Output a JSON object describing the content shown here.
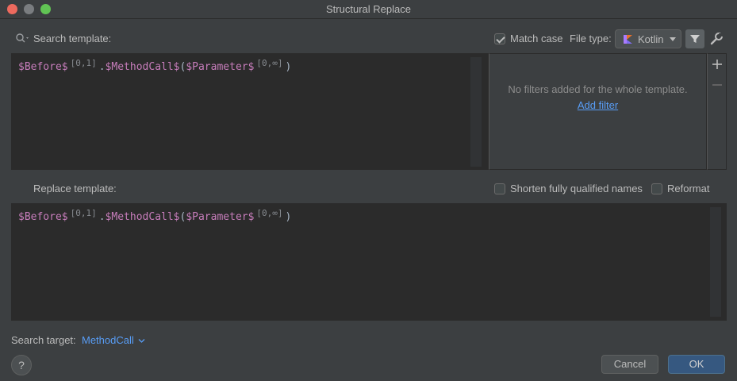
{
  "window": {
    "title": "Structural Replace"
  },
  "search": {
    "label": "Search template:",
    "match_case_label": "Match case",
    "match_case_checked": true,
    "file_type_label": "File type:",
    "file_type_value": "Kotlin",
    "code": {
      "before": "$Before$",
      "before_badge": "[0,1]",
      "dot": ".",
      "method": "$MethodCall$",
      "open_paren": "(",
      "param": "$Parameter$",
      "param_badge": "[0,∞]",
      "close_paren": ")"
    }
  },
  "filters": {
    "empty_text": "No filters added for the whole template.",
    "add_filter_link": "Add filter"
  },
  "replace": {
    "label": "Replace template:",
    "shorten_label": "Shorten fully qualified names",
    "shorten_checked": false,
    "reformat_label": "Reformat",
    "reformat_checked": false,
    "code": {
      "before": "$Before$",
      "before_badge": "[0,1]",
      "dot": ".",
      "method": "$MethodCall$",
      "open_paren": "(",
      "param": "$Parameter$",
      "param_badge": "[0,∞]",
      "close_paren": ")"
    }
  },
  "target": {
    "label": "Search target:",
    "value": "MethodCall"
  },
  "buttons": {
    "help": "?",
    "cancel": "Cancel",
    "ok": "OK"
  },
  "colors": {
    "accent": "#589df6",
    "ok_button": "#365880",
    "variable": "#c77dbb"
  }
}
